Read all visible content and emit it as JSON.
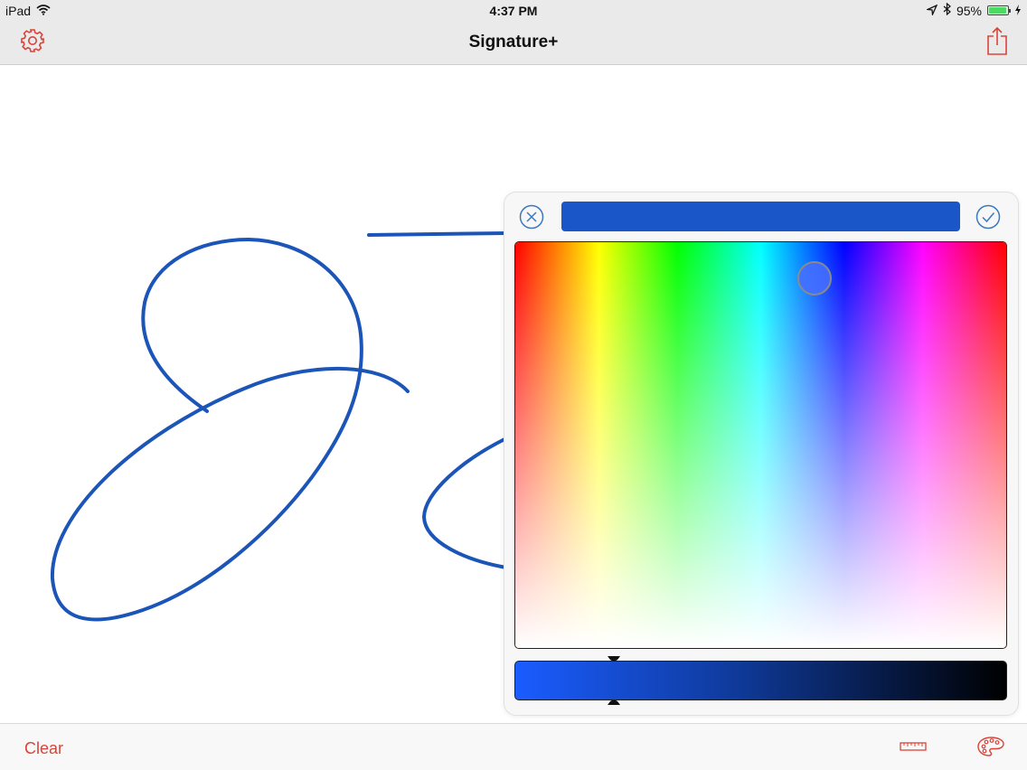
{
  "status_bar": {
    "carrier": "iPad",
    "time": "4:37 PM",
    "battery_percent": "95%",
    "battery_level": 0.95,
    "icons": [
      "wifi-icon",
      "location-arrow-icon",
      "bluetooth-icon",
      "battery-icon",
      "charging-bolt-icon"
    ]
  },
  "nav": {
    "title": "Signature+",
    "left_icon": "settings-gear-icon",
    "right_icon": "share-icon"
  },
  "toolbar": {
    "clear_label": "Clear",
    "icons": [
      "ruler-icon",
      "palette-icon"
    ]
  },
  "color_picker": {
    "cancel_icon": "close-circle-icon",
    "confirm_icon": "checkmark-circle-icon",
    "selected_color": "#1a56c8",
    "hue_position": 0.61,
    "saturation_position": 0.09,
    "brightness_position": 0.2
  },
  "colors": {
    "accent": "#d9443a",
    "ink": "#1c55b8",
    "confirm": "#3c78c0"
  }
}
